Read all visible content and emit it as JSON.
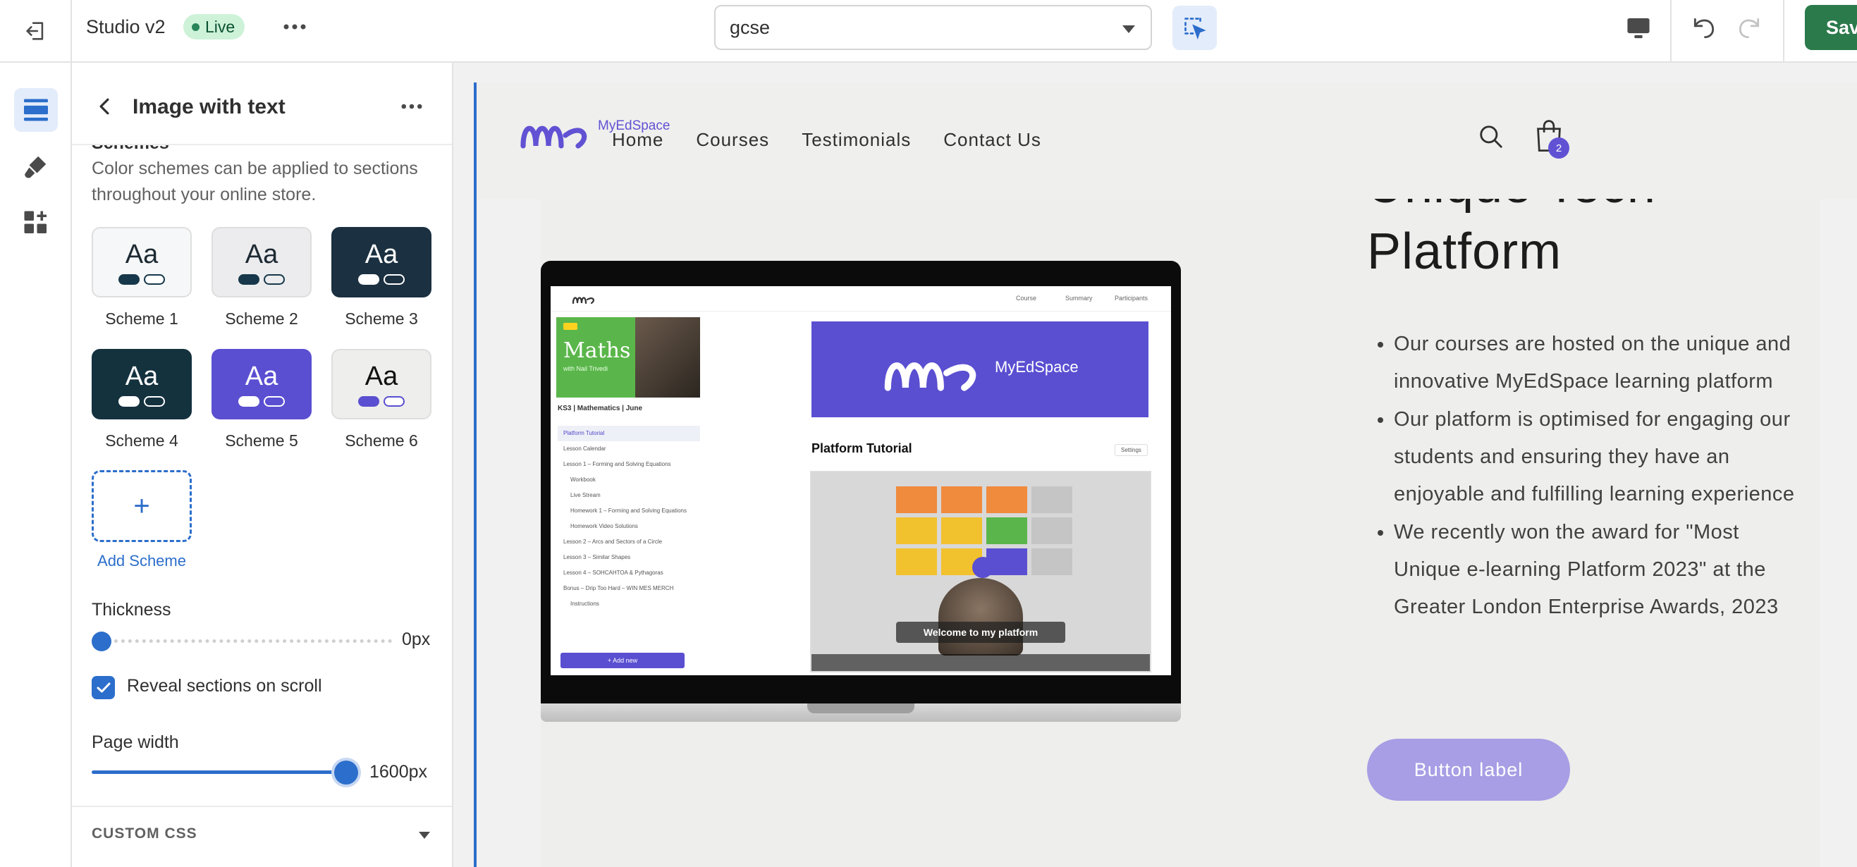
{
  "topbar": {
    "store_name": "Studio v2",
    "status": "Live",
    "theme_template": "gcse",
    "save_label": "Save",
    "save_partial": "Sav"
  },
  "panel": {
    "title": "Image with text",
    "section_heading": "Schemes",
    "description": "Color schemes can be applied to sections throughout your online store.",
    "schemes": [
      {
        "label": "Scheme 1",
        "sample": "Aa",
        "bg": "#f6f7f8",
        "fg": "#1d2a33",
        "pill1": "#17384a",
        "pill2": "#ffffff",
        "pill2border": "#17384a"
      },
      {
        "label": "Scheme 2",
        "sample": "Aa",
        "bg": "#ececee",
        "fg": "#1d2a33",
        "pill1": "#17384a",
        "pill2": "#ececee",
        "pill2border": "#17384a"
      },
      {
        "label": "Scheme 3",
        "sample": "Aa",
        "bg": "#1b3040",
        "fg": "#ffffff",
        "pill1": "#ffffff",
        "pill2": "#1b3040",
        "pill2border": "#ffffff"
      },
      {
        "label": "Scheme 4",
        "sample": "Aa",
        "bg": "#14313e",
        "fg": "#ffffff",
        "pill1": "#ffffff",
        "pill2": "#14313e",
        "pill2border": "#ffffff"
      },
      {
        "label": "Scheme 5",
        "sample": "Aa",
        "bg": "#5a4fd1",
        "fg": "#ffffff",
        "pill1": "#ffffff",
        "pill2": "#5a4fd1",
        "pill2border": "#ffffff"
      },
      {
        "label": "Scheme 6",
        "sample": "Aa",
        "bg": "#eeeeec",
        "fg": "#111111",
        "pill1": "#5a4fd1",
        "pill2": "#ffffff",
        "pill2border": "#5a4fd1"
      }
    ],
    "add_scheme_symbol": "+",
    "add_scheme_label": "Add Scheme",
    "thickness_label": "Thickness",
    "thickness_value": "0px",
    "thickness_level": 0,
    "reveal_label": "Reveal sections on scroll",
    "reveal_checked": true,
    "page_width_label": "Page width",
    "page_width_value": "1600px",
    "page_width_level": 1,
    "custom_css_label": "CUSTOM CSS"
  },
  "preview": {
    "logo_text": "MyEdSpace",
    "nav": [
      "Home",
      "Courses",
      "Testimonials",
      "Contact Us"
    ],
    "cart_count": "2",
    "headline_line1": "Unique Tech",
    "headline_line2": "Platform",
    "bullets": [
      "Our courses are hosted on the unique and innovative MyEdSpace learning platform",
      "Our platform is optimised for engaging our students and ensuring they have an enjoyable and fulfilling learning experience",
      "We recently won the award for \"Most Unique e-learning Platform 2023\" at the Greater London Enterprise Awards, 2023"
    ],
    "button_label": "Button label",
    "mock": {
      "tabs": [
        "Course",
        "Summary",
        "Participants"
      ],
      "tile_title": "Maths",
      "tile_sub": "with Nail Trivedi",
      "course_title": "KS3 | Mathematics | June",
      "side_items": [
        "Platform Tutorial",
        "Lesson Calendar",
        "Lesson 1 – Forming and Solving Equations",
        "Workbook",
        "Live Stream",
        "Homework 1 – Forming and Solving Equations",
        "Homework Video Solutions",
        "Lesson 2 – Arcs and Sectors of a Circle",
        "Lesson 3 – Similar Shapes",
        "Lesson 4 – SOHCAHTOA & Pythagoras",
        "Bonus – Drip Too Hard – WIN MES MERCH",
        "Instructions"
      ],
      "add_new": "+ Add new",
      "banner_text": "MyEdSpace",
      "tutorial_title": "Platform Tutorial",
      "settings": "Settings",
      "video_caption": "Welcome to my platform"
    }
  }
}
